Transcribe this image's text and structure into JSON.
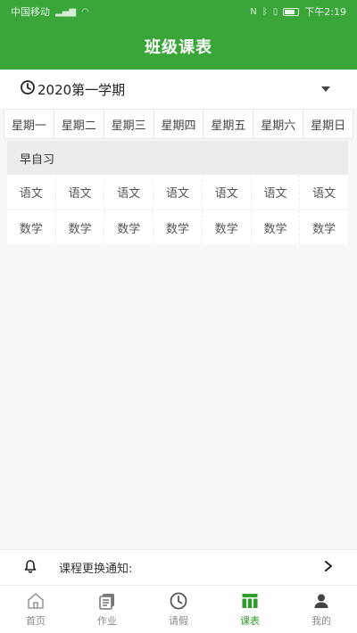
{
  "status_bar": {
    "carrier": "中国移动",
    "time": "下午2:19"
  },
  "title": "班级课表",
  "term": {
    "label": "2020第一学期"
  },
  "weekdays": [
    "星期一",
    "星期二",
    "星期三",
    "星期四",
    "星期五",
    "星期六",
    "星期日"
  ],
  "sections": [
    {
      "name": "早自习",
      "rows": [
        [
          "语文",
          "语文",
          "语文",
          "语文",
          "语文",
          "语文",
          "语文"
        ],
        [
          "数学",
          "数学",
          "数学",
          "数学",
          "数学",
          "数学",
          "数学"
        ]
      ]
    }
  ],
  "notice": {
    "label": "课程更换通知:"
  },
  "tabs": [
    {
      "label": "首页",
      "icon": "home-icon",
      "active": false
    },
    {
      "label": "作业",
      "icon": "homework-icon",
      "active": false
    },
    {
      "label": "请假",
      "icon": "clock-icon",
      "active": false
    },
    {
      "label": "课表",
      "icon": "timetable-icon",
      "active": true
    },
    {
      "label": "我的",
      "icon": "user-icon",
      "active": false
    }
  ],
  "colors": {
    "brand_green": "#3aa63a",
    "active_tab": "#2e9e2e"
  }
}
